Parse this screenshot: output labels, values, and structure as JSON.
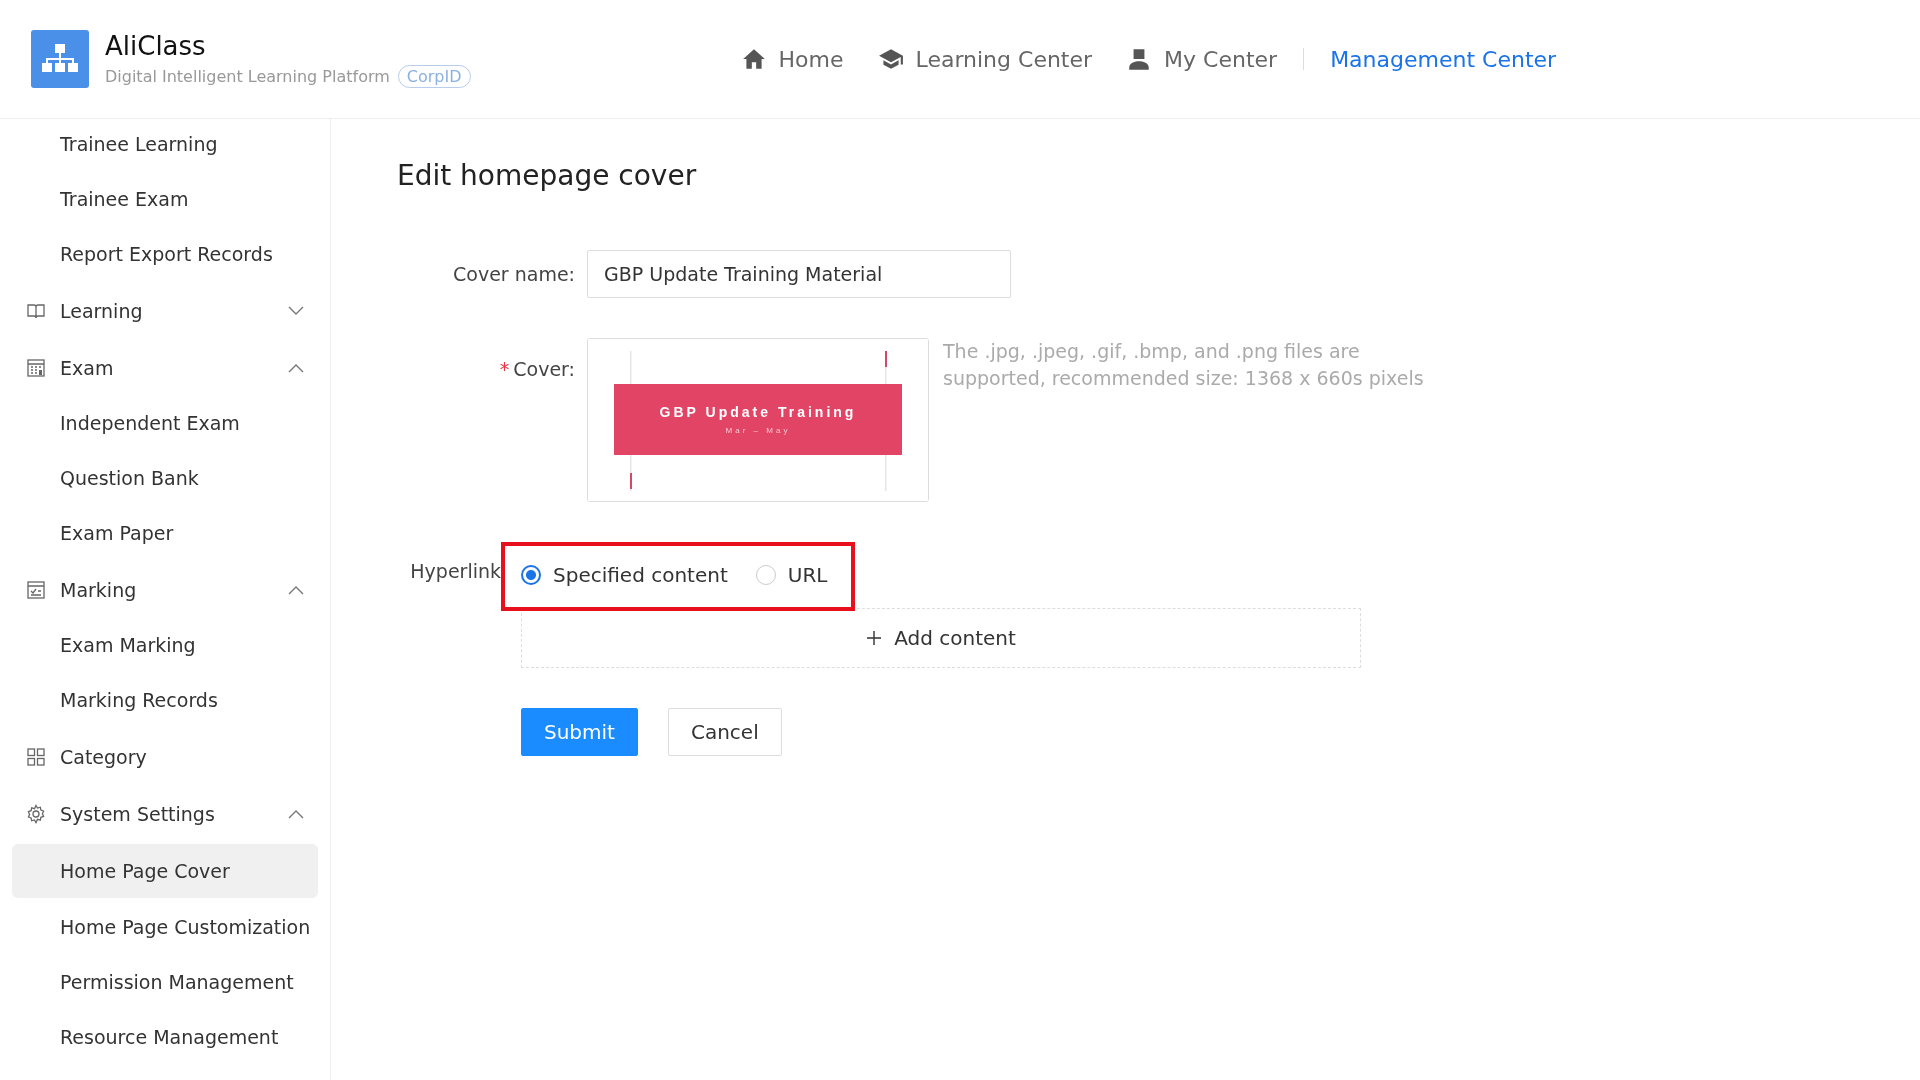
{
  "header": {
    "app_name": "AliClass",
    "subtitle": "Digital Intelligent Learning Platform",
    "badge": "CorpID",
    "nav": [
      {
        "label": "Home",
        "selected": false
      },
      {
        "label": "Learning Center",
        "selected": false
      },
      {
        "label": "My Center",
        "selected": false
      },
      {
        "label": "Management Center",
        "selected": true
      }
    ]
  },
  "sidebar": {
    "items": [
      {
        "kind": "item",
        "label": "Trainee Learning",
        "selected": false
      },
      {
        "kind": "item",
        "label": "Trainee Exam",
        "selected": false
      },
      {
        "kind": "item",
        "label": "Report Export Records",
        "selected": false
      },
      {
        "kind": "group",
        "label": "Learning",
        "expanded": false
      },
      {
        "kind": "group",
        "label": "Exam",
        "expanded": true,
        "children": [
          {
            "label": "Independent Exam",
            "selected": false
          },
          {
            "label": "Question Bank",
            "selected": false
          },
          {
            "label": "Exam Paper",
            "selected": false
          }
        ]
      },
      {
        "kind": "group",
        "label": "Marking",
        "expanded": true,
        "children": [
          {
            "label": "Exam Marking",
            "selected": false
          },
          {
            "label": "Marking Records",
            "selected": false
          }
        ]
      },
      {
        "kind": "link",
        "label": "Category"
      },
      {
        "kind": "group",
        "label": "System Settings",
        "expanded": true,
        "children": [
          {
            "label": "Home Page Cover",
            "selected": true
          },
          {
            "label": "Home Page Customization",
            "selected": false
          },
          {
            "label": "Permission Management",
            "selected": false
          },
          {
            "label": "Resource Management",
            "selected": false
          }
        ]
      }
    ]
  },
  "form": {
    "title": "Edit homepage cover",
    "cover_name": {
      "label": "Cover name:",
      "value": "GBP Update Training Material"
    },
    "cover": {
      "label": "Cover:",
      "required_mark": "*",
      "image_title": "GBP Update Training",
      "image_subtitle": "Mar – May",
      "hint": "The .jpg, .jpeg, .gif, .bmp, and .png files are supported, recommended size: 1368 x 660s pixels"
    },
    "hyperlink": {
      "label": "Hyperlink",
      "highlighted": true,
      "options": [
        {
          "label": "Specified content",
          "selected": true
        },
        {
          "label": "URL",
          "selected": false
        }
      ],
      "add_button": "Add content"
    },
    "buttons": [
      {
        "label": "Submit",
        "kind": "primary"
      },
      {
        "label": "Cancel",
        "kind": "default"
      }
    ]
  }
}
